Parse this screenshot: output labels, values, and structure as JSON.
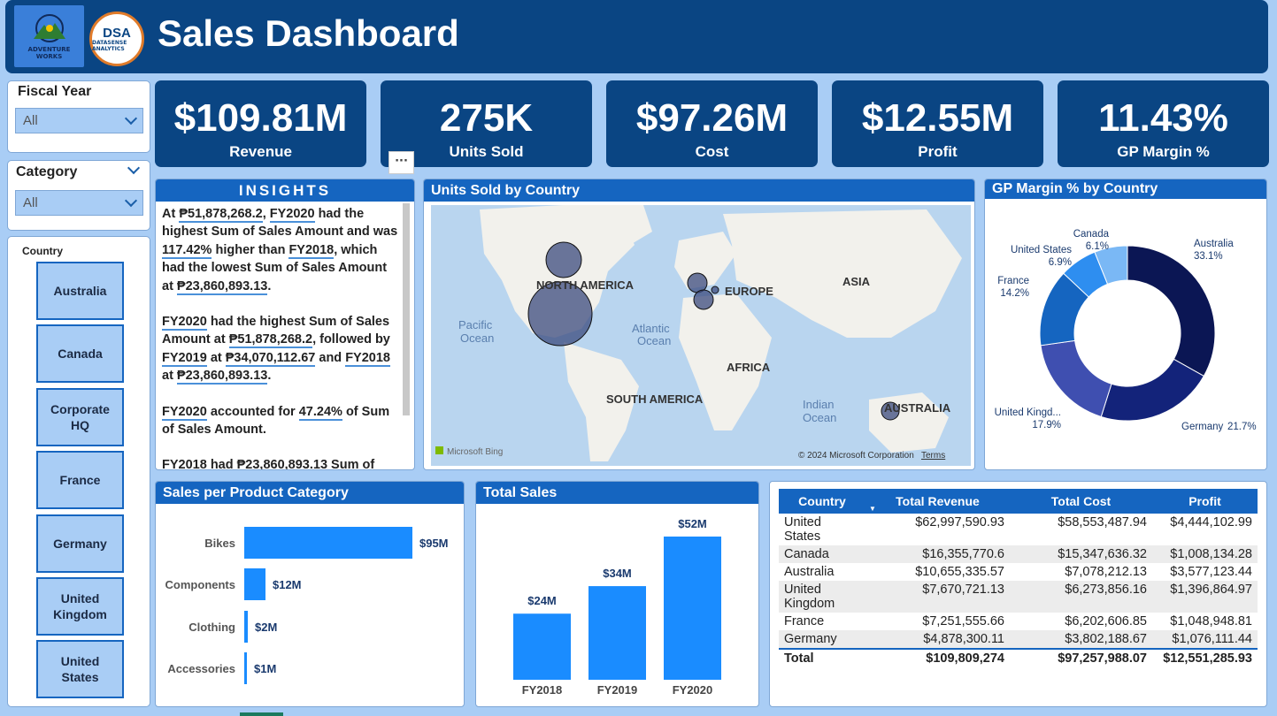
{
  "header": {
    "title": "Sales Dashboard",
    "logo1_text": "ADVENTURE WORKS",
    "logo2_big": "DSA",
    "logo2_small": "DATASENSE ANALYTICS"
  },
  "slicers": {
    "fiscal_year": {
      "label": "Fiscal Year",
      "value": "All"
    },
    "category": {
      "label": "Category",
      "value": "All"
    },
    "country": {
      "label": "Country",
      "items": [
        "Australia",
        "Canada",
        "Corporate HQ",
        "France",
        "Germany",
        "United Kingdom",
        "United States"
      ]
    }
  },
  "kpis": [
    {
      "value": "$109.81M",
      "label": "Revenue"
    },
    {
      "value": "275K",
      "label": "Units Sold"
    },
    {
      "value": "$97.26M",
      "label": "Cost"
    },
    {
      "value": "$12.55M",
      "label": "Profit"
    },
    {
      "value": "11.43%",
      "label": "GP Margin %"
    }
  ],
  "more_options": "···",
  "insights": {
    "title": "INSIGHTS",
    "p1": [
      "At ",
      "₱51,878,268.2",
      ", ",
      "FY2020",
      " had the highest Sum of Sales Amount and was ",
      "117.42%",
      " higher than ",
      "FY2018",
      ", which had the lowest Sum of Sales Amount at ",
      "₱23,860,893.13",
      "."
    ],
    "p2": [
      "FY2020",
      " had the highest Sum of Sales Amount at ",
      "₱51,878,268.2",
      ", followed by ",
      "FY2019",
      " at ",
      "₱34,070,112.67",
      " and ",
      "FY2018",
      " at ",
      "₱23,860,893.13",
      "."
    ],
    "p3": [
      "FY2020",
      " accounted for ",
      "47.24%",
      " of Sum of Sales Amount."
    ],
    "p4": "FY2018 had ₱23,860,893.13 Sum of"
  },
  "map": {
    "title": "Units Sold by Country",
    "labels": {
      "north_america": "NORTH AMERICA",
      "europe": "EUROPE",
      "asia": "ASIA",
      "africa": "AFRICA",
      "south_america": "SOUTH AMERICA",
      "australia": "AUSTRALIA",
      "pacific_1": "Pacific",
      "pacific_2": "Ocean",
      "atlantic_1": "Atlantic",
      "atlantic_2": "Ocean",
      "indian_1": "Indian",
      "indian_2": "Ocean"
    },
    "attribution_bing": "Microsoft Bing",
    "copyright": "© 2024 Microsoft Corporation",
    "terms": "Terms"
  },
  "colors": {
    "header": "#0a4583",
    "accent": "#1565c0",
    "bar": "#1a8cff",
    "background": "#a9cdf5"
  },
  "charts": {
    "donut_title": "GP Margin % by Country",
    "category_title": "Sales per Product Category",
    "total_title": "Total Sales"
  },
  "chart_data": [
    {
      "type": "pie",
      "title": "GP Margin % by Country",
      "categories": [
        "Australia",
        "Germany",
        "United Kingd...",
        "France",
        "United States",
        "Canada"
      ],
      "values": [
        33.1,
        21.7,
        17.9,
        14.2,
        6.9,
        6.1
      ],
      "value_labels": [
        "33.1%",
        "21.7%",
        "17.9%",
        "14.2%",
        "6.9%",
        "6.1%"
      ],
      "colors": [
        "#0b1654",
        "#13237a",
        "#3f4fb0",
        "#1565c0",
        "#2e8ef0",
        "#7ab8f5"
      ]
    },
    {
      "type": "bar",
      "orientation": "horizontal",
      "title": "Sales per Product Category",
      "categories": [
        "Bikes",
        "Components",
        "Clothing",
        "Accessories"
      ],
      "values": [
        95,
        12,
        2,
        1
      ],
      "value_labels": [
        "$95M",
        "$12M",
        "$2M",
        "$1M"
      ],
      "xlim": [
        0,
        100
      ]
    },
    {
      "type": "bar",
      "title": "Total Sales",
      "categories": [
        "FY2018",
        "FY2019",
        "FY2020"
      ],
      "values": [
        24,
        34,
        52
      ],
      "value_labels": [
        "$24M",
        "$34M",
        "$52M"
      ],
      "ylim": [
        0,
        55
      ]
    },
    {
      "type": "scatter",
      "title": "Units Sold by Country",
      "series": [
        {
          "name": "Canada",
          "value": 18
        },
        {
          "name": "United States",
          "value": 100
        },
        {
          "name": "United Kingdom",
          "value": 8
        },
        {
          "name": "France",
          "value": 8
        },
        {
          "name": "Germany",
          "value": 1
        },
        {
          "name": "Australia",
          "value": 7
        }
      ]
    },
    {
      "type": "table",
      "columns": [
        "Country",
        "Total Revenue",
        "Total Cost",
        "Profit"
      ],
      "rows": [
        [
          "United States",
          "$62,997,590.93",
          "$58,553,487.94",
          "$4,444,102.99"
        ],
        [
          "Canada",
          "$16,355,770.6",
          "$15,347,636.32",
          "$1,008,134.28"
        ],
        [
          "Australia",
          "$10,655,335.57",
          "$7,078,212.13",
          "$3,577,123.44"
        ],
        [
          "United Kingdom",
          "$7,670,721.13",
          "$6,273,856.16",
          "$1,396,864.97"
        ],
        [
          "France",
          "$7,251,555.66",
          "$6,202,606.85",
          "$1,048,948.81"
        ],
        [
          "Germany",
          "$4,878,300.11",
          "$3,802,188.67",
          "$1,076,111.44"
        ]
      ],
      "total": [
        "Total",
        "$109,809,274",
        "$97,257,988.07",
        "$12,551,285.93"
      ]
    }
  ]
}
